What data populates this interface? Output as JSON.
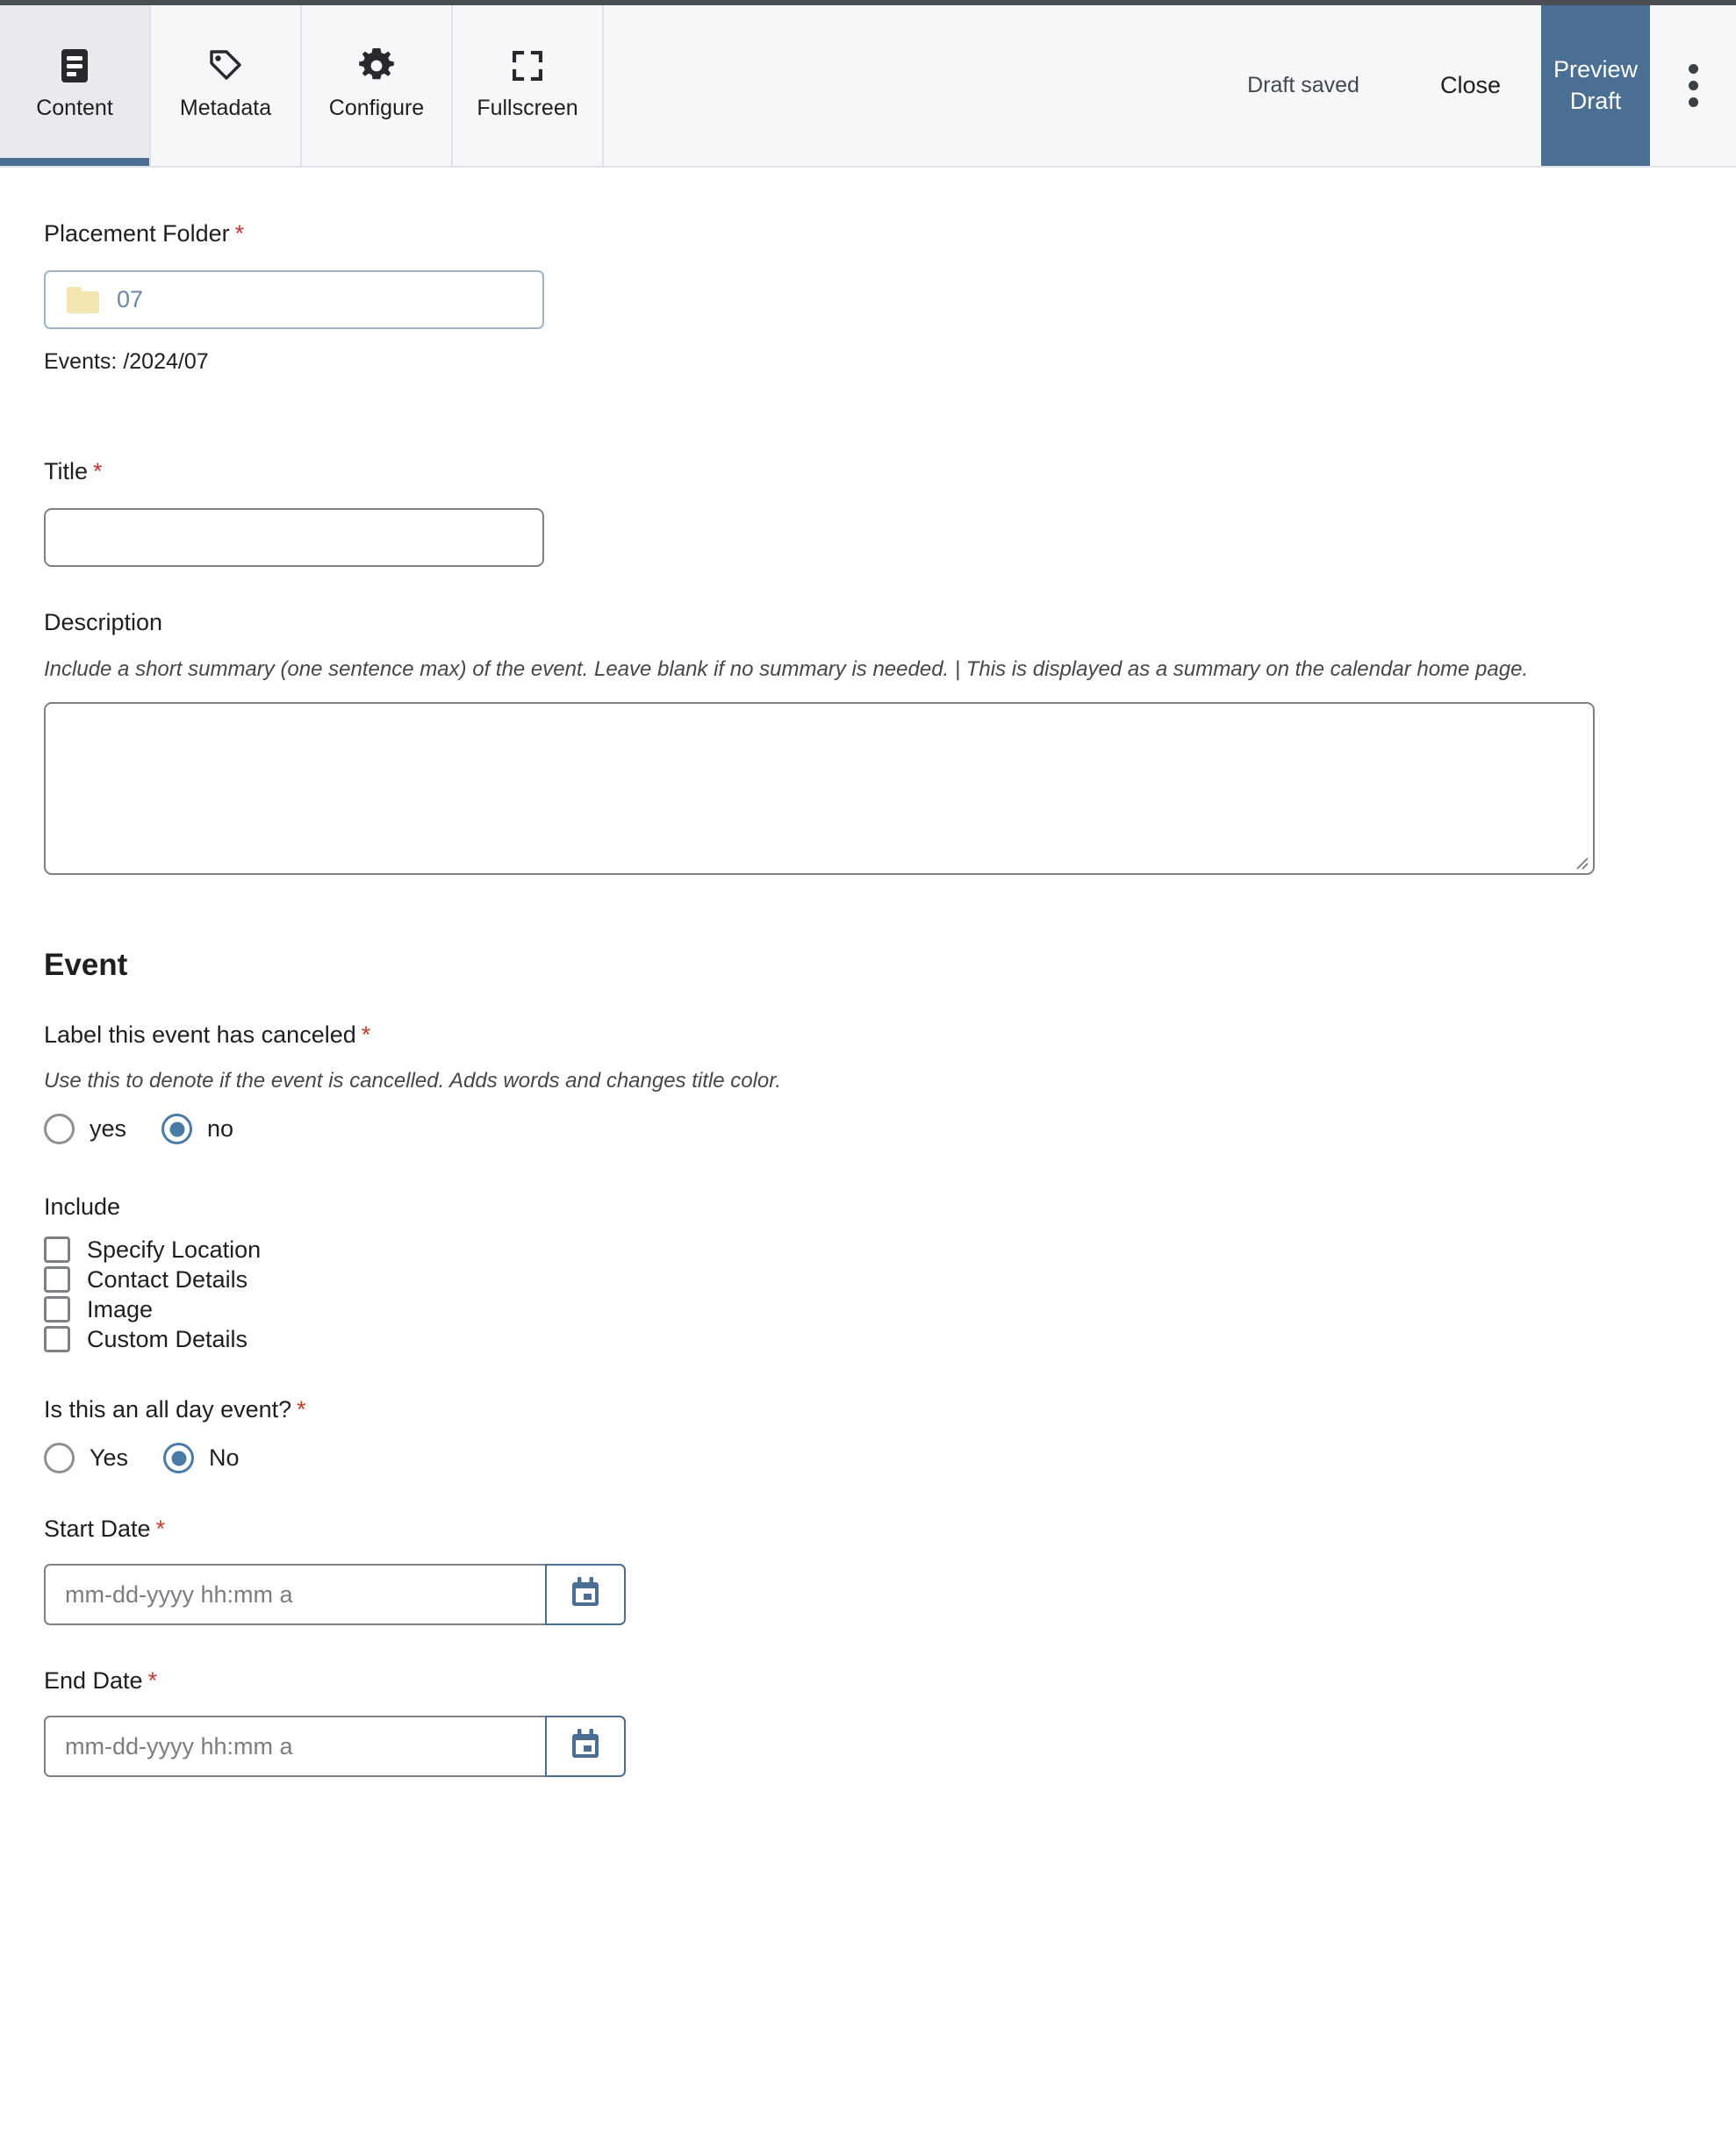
{
  "toolbar": {
    "tabs": [
      {
        "label": "Content",
        "icon": "document-lines-icon",
        "active": true
      },
      {
        "label": "Metadata",
        "icon": "tag-icon",
        "active": false
      },
      {
        "label": "Configure",
        "icon": "gear-icon",
        "active": false
      },
      {
        "label": "Fullscreen",
        "icon": "expand-icon",
        "active": false
      }
    ],
    "draft_status": "Draft saved",
    "close_label": "Close",
    "preview_label": "Preview Draft",
    "more_icon": "kebab-menu-icon",
    "accent_color": "#4a6f92",
    "active_tab_bg": "#e8eaed",
    "toolbar_bg": "#f5f7f9"
  },
  "form": {
    "placement": {
      "label": "Placement Folder",
      "required_mark": "*",
      "folder_icon": "folder-icon",
      "value": "07",
      "path": "Events: /2024/07"
    },
    "title": {
      "label": "Title",
      "required_mark": "*",
      "value": ""
    },
    "description": {
      "label": "Description",
      "help": "Include a short summary (one sentence max) of the event. Leave blank if no summary is needed. | This is displayed as a summary on the calendar home page.",
      "value": ""
    },
    "event_section": {
      "heading": "Event",
      "canceled": {
        "label": "Label this event has canceled",
        "required_mark": "*",
        "help": "Use this to denote if the event is cancelled. Adds words and changes title color.",
        "options": [
          {
            "label": "yes",
            "checked": false
          },
          {
            "label": "no",
            "checked": true
          }
        ]
      },
      "include": {
        "label": "Include",
        "items": [
          {
            "label": "Specify Location",
            "checked": false
          },
          {
            "label": "Contact Details",
            "checked": false
          },
          {
            "label": "Image",
            "checked": false
          },
          {
            "label": "Custom Details",
            "checked": false
          }
        ]
      },
      "all_day": {
        "label": "Is this an all day event?",
        "required_mark": "*",
        "options": [
          {
            "label": "Yes",
            "checked": false
          },
          {
            "label": "No",
            "checked": true
          }
        ]
      },
      "start_date": {
        "label": "Start Date",
        "required_mark": "*",
        "placeholder": "mm-dd-yyyy hh:mm a",
        "value": "",
        "picker_icon": "calendar-icon"
      },
      "end_date": {
        "label": "End Date",
        "required_mark": "*",
        "placeholder": "mm-dd-yyyy hh:mm a",
        "value": "",
        "picker_icon": "calendar-icon"
      }
    }
  }
}
